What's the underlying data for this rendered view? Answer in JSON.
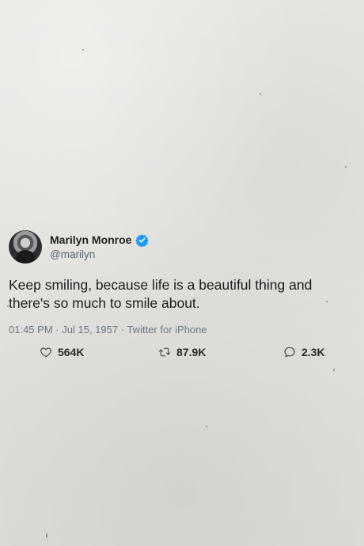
{
  "tweet": {
    "display_name": "Marilyn Monroe",
    "handle": "@marilyn",
    "verified": true,
    "text": "Keep smiling, because life is a beautiful thing and there's so much to smile about.",
    "time": "01:45 PM",
    "date": "Jul 15, 1957",
    "source": "Twitter for iPhone",
    "separator": "·"
  },
  "actions": {
    "likes": {
      "icon": "heart-icon",
      "count": "564K"
    },
    "retweets": {
      "icon": "retweet-icon",
      "count": "87.9K"
    },
    "replies": {
      "icon": "reply-icon",
      "count": "2.3K"
    }
  },
  "colors": {
    "background": "#e3e3df",
    "verified_badge": "#1d9bf0",
    "meta_text": "#6a7680",
    "body_text": "#1d1d1d"
  }
}
